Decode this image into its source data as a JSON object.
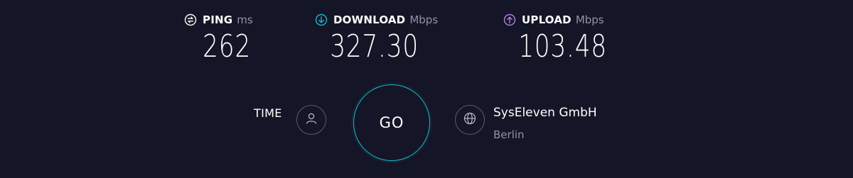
{
  "metrics": {
    "ping": {
      "label": "PING",
      "unit": "ms",
      "value": "262",
      "icon": "ping-icon"
    },
    "download": {
      "label": "DOWNLOAD",
      "unit": "Mbps",
      "value": "327.30",
      "icon": "download-arrow-icon"
    },
    "upload": {
      "label": "UPLOAD",
      "unit": "Mbps",
      "value": "103.48",
      "icon": "upload-arrow-icon"
    }
  },
  "time": {
    "label": "TIME",
    "icon": "person-icon"
  },
  "go_button": {
    "label": "GO"
  },
  "server": {
    "name": "SysEleven GmbH",
    "location": "Berlin",
    "icon": "globe-icon"
  },
  "colors": {
    "background": "#141526",
    "download_accent": "#1fb7c9",
    "upload_accent": "#b37ee3",
    "go_ring": "#1fb7c9",
    "muted_text": "#9193a8"
  }
}
